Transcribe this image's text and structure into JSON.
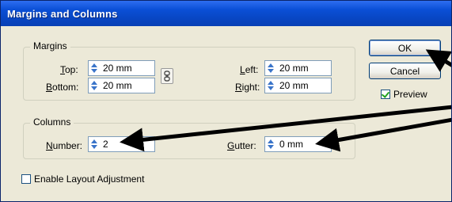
{
  "window": {
    "title": "Margins and Columns"
  },
  "margins": {
    "group_label": "Margins",
    "top": {
      "label": "Top:",
      "value": "20 mm"
    },
    "bottom": {
      "label": "Bottom:",
      "value": "20 mm"
    },
    "left": {
      "label": "Left:",
      "value": "20 mm"
    },
    "right": {
      "label": "Right:",
      "value": "20 mm"
    }
  },
  "columns": {
    "group_label": "Columns",
    "number": {
      "label": "Number:",
      "value": "2"
    },
    "gutter": {
      "label": "Gutter:",
      "value": "0 mm"
    }
  },
  "buttons": {
    "ok": "OK",
    "cancel": "Cancel"
  },
  "preview": {
    "label": "Preview",
    "checked": true
  },
  "layout_adjustment": {
    "label": "Enable Layout Adjustment",
    "checked": false
  },
  "icons": {
    "spinner": "spinner-arrows-icon",
    "chain_link": "chain-link-icon",
    "annotation_arrow": "annotation-arrow-icon"
  },
  "colors": {
    "title_bar": "#0a4fd6",
    "accent": "#3a74c9",
    "arrow": "#000000"
  }
}
